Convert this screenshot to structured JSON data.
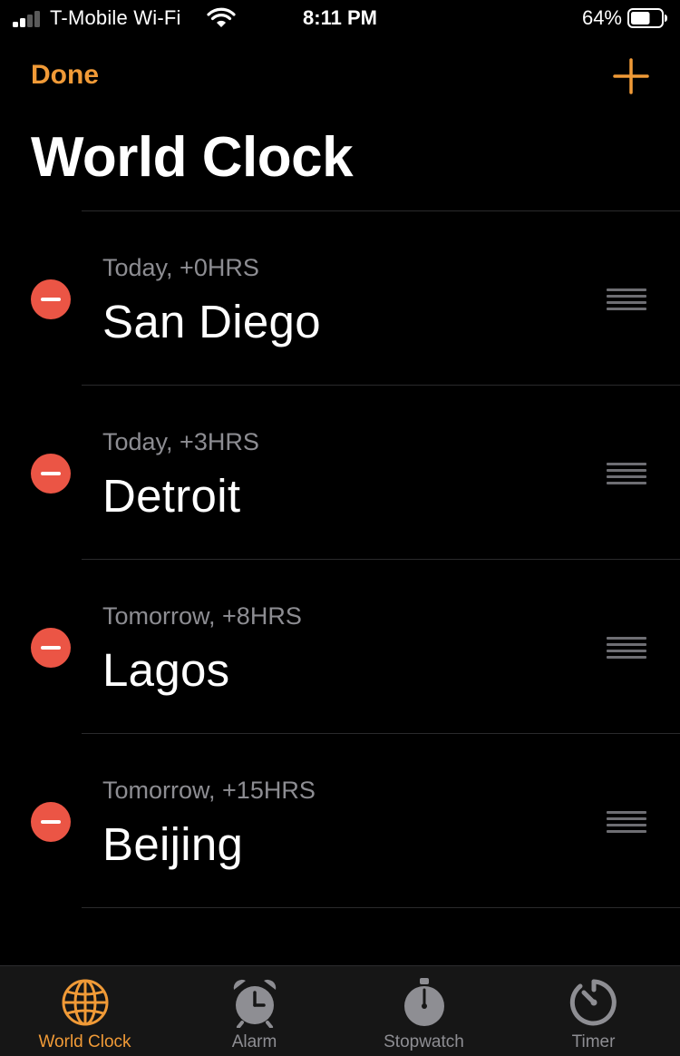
{
  "status_bar": {
    "carrier": "T-Mobile Wi-Fi",
    "time": "8:11 PM",
    "battery_percent": "64%",
    "battery_level": 0.64
  },
  "nav": {
    "done_label": "Done",
    "add_icon": "plus-icon"
  },
  "title": "World Clock",
  "clocks": [
    {
      "subtitle": "Today, +0HRS",
      "city": "San Diego"
    },
    {
      "subtitle": "Today, +3HRS",
      "city": "Detroit"
    },
    {
      "subtitle": "Tomorrow, +8HRS",
      "city": "Lagos"
    },
    {
      "subtitle": "Tomorrow, +15HRS",
      "city": "Beijing"
    }
  ],
  "tabs": [
    {
      "label": "World Clock",
      "icon": "globe-icon",
      "active": true
    },
    {
      "label": "Alarm",
      "icon": "alarm-clock-icon",
      "active": false
    },
    {
      "label": "Stopwatch",
      "icon": "stopwatch-icon",
      "active": false
    },
    {
      "label": "Timer",
      "icon": "timer-icon",
      "active": false
    }
  ],
  "colors": {
    "accent": "#f09a37",
    "delete": "#eb5545",
    "inactive_tab": "#8e8e93",
    "background": "#000000"
  }
}
